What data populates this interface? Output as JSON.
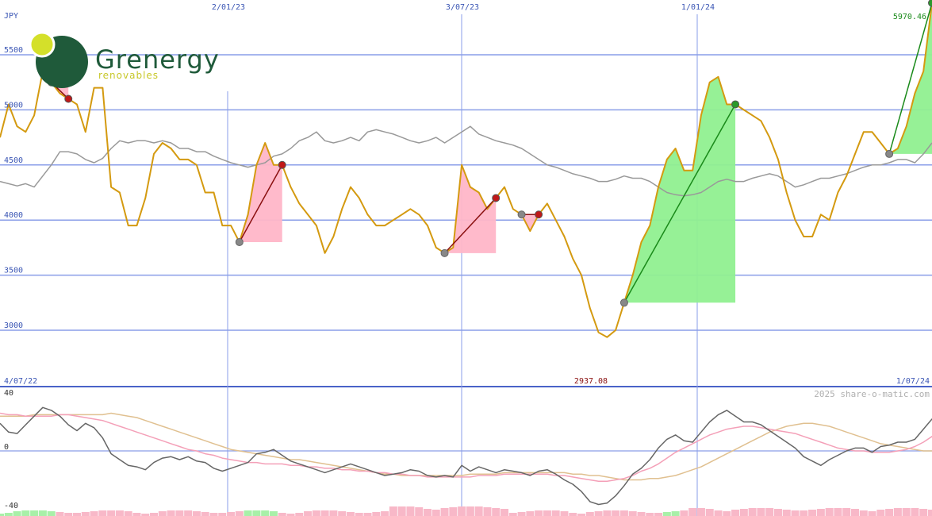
{
  "logo": {
    "name": "Grenergy",
    "tagline": "renovables"
  },
  "currency_label": "JPY",
  "date_labels_top": [
    "2/01/23",
    "3/07/23",
    "1/01/24"
  ],
  "range": {
    "start": "4/07/22",
    "end": "1/07/24"
  },
  "last_price_label": "5970.46",
  "min_price_label": "2937.08",
  "credit": "2025 share-o-matic.com",
  "colors": {
    "price": "#d49a10",
    "average": "#999999",
    "gain": "#90f090",
    "loss": "#ffb6c8",
    "grid": "#8a9ee8",
    "osc_main": "#666666",
    "osc_pink": "#f4a0b8",
    "osc_tan": "#e0c090"
  },
  "chart_data": [
    {
      "type": "line",
      "title": "",
      "ylabel": "JPY",
      "yticks": [
        3000,
        3500,
        4000,
        4500,
        5000,
        5500
      ],
      "ylim": [
        2525,
        5975
      ],
      "x_labels": [
        "4/07/22",
        "2/01/23",
        "3/07/23",
        "1/01/24",
        "1/07/24"
      ],
      "series": [
        {
          "values": [
            4750,
            5050,
            4850,
            4800,
            4950,
            5350,
            5250,
            5150,
            5100,
            5050,
            4800,
            5200,
            5200,
            4300,
            4250,
            3950,
            3950,
            4200,
            4600,
            4700,
            4650,
            4550,
            4550,
            4500,
            4250,
            4250,
            3950,
            3950,
            3800,
            4050,
            4500,
            4700,
            4500,
            4500,
            4300,
            4150,
            4050,
            3950,
            3700,
            3850,
            4100,
            4300,
            4200,
            4050,
            3950,
            3950,
            4000,
            4050,
            4100,
            4050,
            3950,
            3750,
            3700,
            3750,
            4500,
            4300,
            4250,
            4100,
            4200,
            4300,
            4100,
            4050,
            3900,
            4050,
            4150,
            4000,
            3850,
            3650,
            3500,
            3200,
            2980,
            2937,
            3000,
            3250,
            3500,
            3800,
            3950,
            4300,
            4550,
            4650,
            4450,
            4450,
            4950,
            5250,
            5300,
            5050,
            5050,
            5000,
            4950,
            4900,
            4750,
            4550,
            4250,
            4000,
            3850,
            3850,
            4050,
            4000,
            4250,
            4400,
            4600,
            4800,
            4800,
            4700,
            4600,
            4650,
            4850,
            5150,
            5350,
            5970
          ]
        },
        {
          "values": [
            4350,
            4330,
            4310,
            4330,
            4300,
            4400,
            4500,
            4620,
            4620,
            4600,
            4550,
            4520,
            4560,
            4650,
            4720,
            4700,
            4720,
            4720,
            4700,
            4720,
            4700,
            4650,
            4650,
            4620,
            4620,
            4580,
            4550,
            4520,
            4500,
            4480,
            4500,
            4520,
            4580,
            4600,
            4650,
            4720,
            4750,
            4800,
            4720,
            4700,
            4720,
            4750,
            4720,
            4800,
            4820,
            4800,
            4780,
            4750,
            4720,
            4700,
            4720,
            4750,
            4700,
            4750,
            4800,
            4850,
            4780,
            4750,
            4720,
            4700,
            4680,
            4650,
            4600,
            4550,
            4500,
            4480,
            4450,
            4420,
            4400,
            4380,
            4350,
            4350,
            4370,
            4400,
            4380,
            4380,
            4350,
            4300,
            4250,
            4230,
            4220,
            4230,
            4250,
            4300,
            4350,
            4370,
            4350,
            4350,
            4380,
            4400,
            4420,
            4400,
            4350,
            4300,
            4320,
            4350,
            4380,
            4380,
            4400,
            4420,
            4450,
            4480,
            4500,
            4500,
            4520,
            4550,
            4550,
            4520,
            4600,
            4700
          ]
        }
      ]
    },
    {
      "type": "line",
      "title": "",
      "ylim": [
        -40,
        40
      ],
      "yticks": [
        -40,
        0,
        40
      ],
      "series": [
        {
          "values": [
            19,
            13,
            12,
            18,
            24,
            30,
            28,
            24,
            18,
            14,
            19,
            16,
            9,
            -2,
            -6,
            -10,
            -11,
            -13,
            -8,
            -5,
            -4,
            -6,
            -4,
            -7,
            -8,
            -12,
            -14,
            -12,
            -10,
            -8,
            -2,
            -1,
            1,
            -3,
            -7,
            -9,
            -11,
            -13,
            -15,
            -13,
            -11,
            -9,
            -11,
            -13,
            -15,
            -17,
            -16,
            -15,
            -13,
            -14,
            -17,
            -18,
            -17,
            -18,
            -10,
            -14,
            -11,
            -13,
            -15,
            -13,
            -14,
            -15,
            -17,
            -14,
            -13,
            -16,
            -20,
            -23,
            -28,
            -35,
            -37,
            -36,
            -31,
            -24,
            -16,
            -12,
            -6,
            2,
            8,
            11,
            7,
            6,
            13,
            20,
            25,
            28,
            24,
            20,
            20,
            18,
            14,
            10,
            6,
            2,
            -4,
            -7,
            -10,
            -6,
            -3,
            0,
            2,
            2,
            -1,
            3,
            4,
            6,
            6,
            8,
            15,
            22,
            24
          ]
        },
        {
          "values": [
            26,
            25,
            25,
            24,
            24,
            24,
            24,
            25,
            25,
            24,
            23,
            22,
            21,
            19,
            17,
            15,
            13,
            11,
            9,
            7,
            5,
            3,
            1,
            0,
            -2,
            -3,
            -5,
            -6,
            -7,
            -8,
            -8,
            -9,
            -9,
            -9,
            -10,
            -10,
            -11,
            -11,
            -12,
            -12,
            -13,
            -13,
            -14,
            -14,
            -15,
            -15,
            -16,
            -16,
            -17,
            -17,
            -18,
            -18,
            -18,
            -18,
            -18,
            -18,
            -17,
            -17,
            -17,
            -16,
            -16,
            -16,
            -16,
            -16,
            -16,
            -17,
            -17,
            -18,
            -19,
            -20,
            -21,
            -21,
            -20,
            -19,
            -17,
            -14,
            -12,
            -9,
            -5,
            -1,
            2,
            5,
            8,
            11,
            13,
            15,
            16,
            17,
            17,
            16,
            15,
            14,
            13,
            12,
            10,
            8,
            6,
            4,
            2,
            1,
            0,
            0,
            -1,
            -1,
            -1,
            0,
            1,
            3,
            6,
            10,
            14
          ]
        },
        {
          "values": [
            24,
            24,
            24,
            24,
            25,
            25,
            25,
            25,
            25,
            25,
            25,
            25,
            25,
            26,
            25,
            24,
            23,
            21,
            19,
            17,
            15,
            13,
            11,
            9,
            7,
            5,
            3,
            1,
            0,
            -1,
            -2,
            -3,
            -4,
            -5,
            -6,
            -6,
            -7,
            -8,
            -9,
            -10,
            -11,
            -12,
            -13,
            -14,
            -15,
            -16,
            -16,
            -17,
            -17,
            -17,
            -17,
            -17,
            -17,
            -17,
            -17,
            -16,
            -16,
            -16,
            -16,
            -15,
            -15,
            -15,
            -15,
            -15,
            -15,
            -15,
            -15,
            -16,
            -16,
            -17,
            -17,
            -18,
            -19,
            -20,
            -20,
            -20,
            -19,
            -19,
            -18,
            -17,
            -15,
            -13,
            -11,
            -8,
            -5,
            -2,
            1,
            4,
            7,
            10,
            13,
            15,
            17,
            18,
            19,
            19,
            18,
            17,
            15,
            13,
            11,
            9,
            7,
            5,
            4,
            3,
            2,
            1,
            0,
            0,
            0
          ]
        }
      ]
    }
  ]
}
